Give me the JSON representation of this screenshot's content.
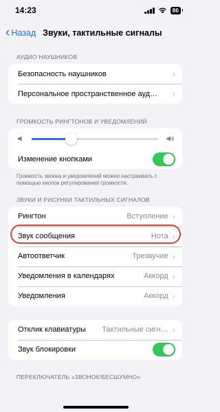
{
  "status": {
    "time": "14:23",
    "battery": "86"
  },
  "nav": {
    "back_label": "Назад",
    "title": "Звуки, тактильные сигналы"
  },
  "headphones": {
    "header": "АУДИО НАУШНИКОВ",
    "rows": [
      {
        "label": "Безопасность наушников"
      },
      {
        "label": "Персональное пространственное ауд…"
      }
    ]
  },
  "volume": {
    "header": "ГРОМКОСТЬ РИНГТОНОВ И УВЕДОМЛЕНИЙ",
    "level": 0.31,
    "change_with_buttons_label": "Изменение кнопками",
    "change_with_buttons_on": true,
    "footnote": "Громкость звонка и уведомлений можно настраивать с помощью кнопок регулирования громкости."
  },
  "sounds": {
    "header": "ЗВУКИ И РИСУНКИ ТАКТИЛЬНЫХ СИГНАЛОВ",
    "rows": [
      {
        "label": "Рингтон",
        "value": "Вступление"
      },
      {
        "label": "Звук сообщения",
        "value": "Нота"
      },
      {
        "label": "Автоответчик",
        "value": "Трезвучие"
      },
      {
        "label": "Уведомления в календарях",
        "value": "Аккорд"
      },
      {
        "label": "Уведомления",
        "value": "Аккорд"
      }
    ]
  },
  "keyboard": {
    "feedback_label": "Отклик клавиатуры",
    "feedback_value": "Тактильные сигн…",
    "lock_sound_label": "Звук блокировки",
    "lock_sound_on": true
  },
  "switch": {
    "header": "ПЕРЕКЛЮЧАТЕЛЬ «ЗВОНОК/БЕСШУМНО»"
  },
  "colors": {
    "accent": "#0a7aff",
    "toggle_on": "#34c759",
    "highlight": "#e0402e"
  }
}
